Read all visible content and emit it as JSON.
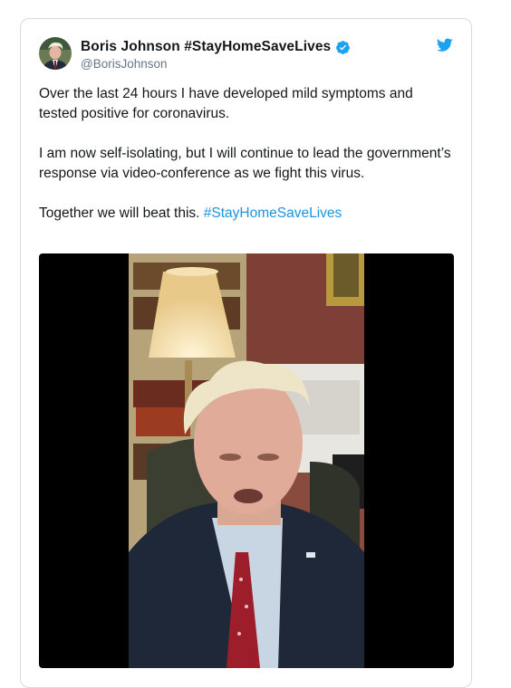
{
  "tweet": {
    "author_name": "Boris Johnson #StayHomeSaveLives",
    "handle": "@BorisJohnson",
    "verified": true,
    "paragraph_1": "Over the last 24 hours I have developed mild symptoms and tested positive for coronavirus.",
    "paragraph_2": "I am now self-isolating, but I will continue to lead the government’s response via video-conference as we fight this virus.",
    "paragraph_3_text": "Together we will beat this. ",
    "hashtag": "#StayHomeSaveLives"
  },
  "icons": {
    "verified": "verified-badge-icon",
    "brand": "twitter-bird-icon"
  },
  "colors": {
    "brand_blue": "#1da1f2",
    "link_blue": "#1b95e0",
    "text": "#14171a",
    "muted": "#657786",
    "border": "#d3dbe2"
  }
}
